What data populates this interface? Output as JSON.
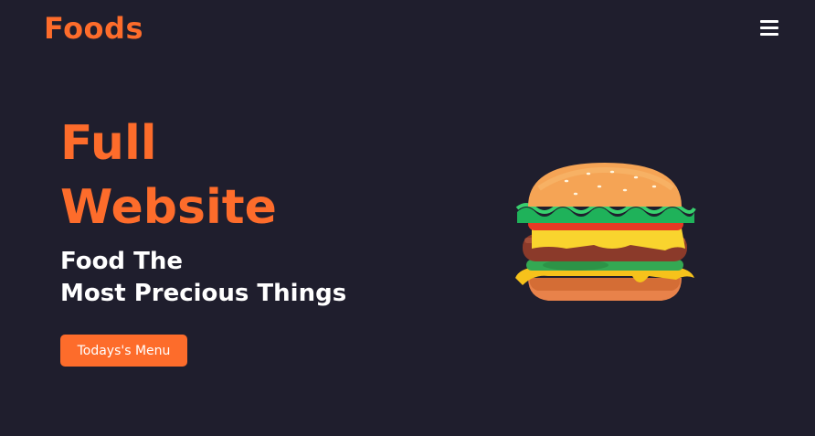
{
  "header": {
    "brand": "Foods",
    "menu_icon": "hamburger-menu-icon"
  },
  "hero": {
    "title_line1": "Full",
    "title_line2": "Website",
    "subtitle_line1": "Food The",
    "subtitle_line2": "Most Precious Things",
    "cta_label": "Todays's Menu",
    "image": "burger-illustration"
  },
  "colors": {
    "background": "#1f1e2d",
    "accent": "#fd6c2b",
    "text": "#ffffff"
  }
}
